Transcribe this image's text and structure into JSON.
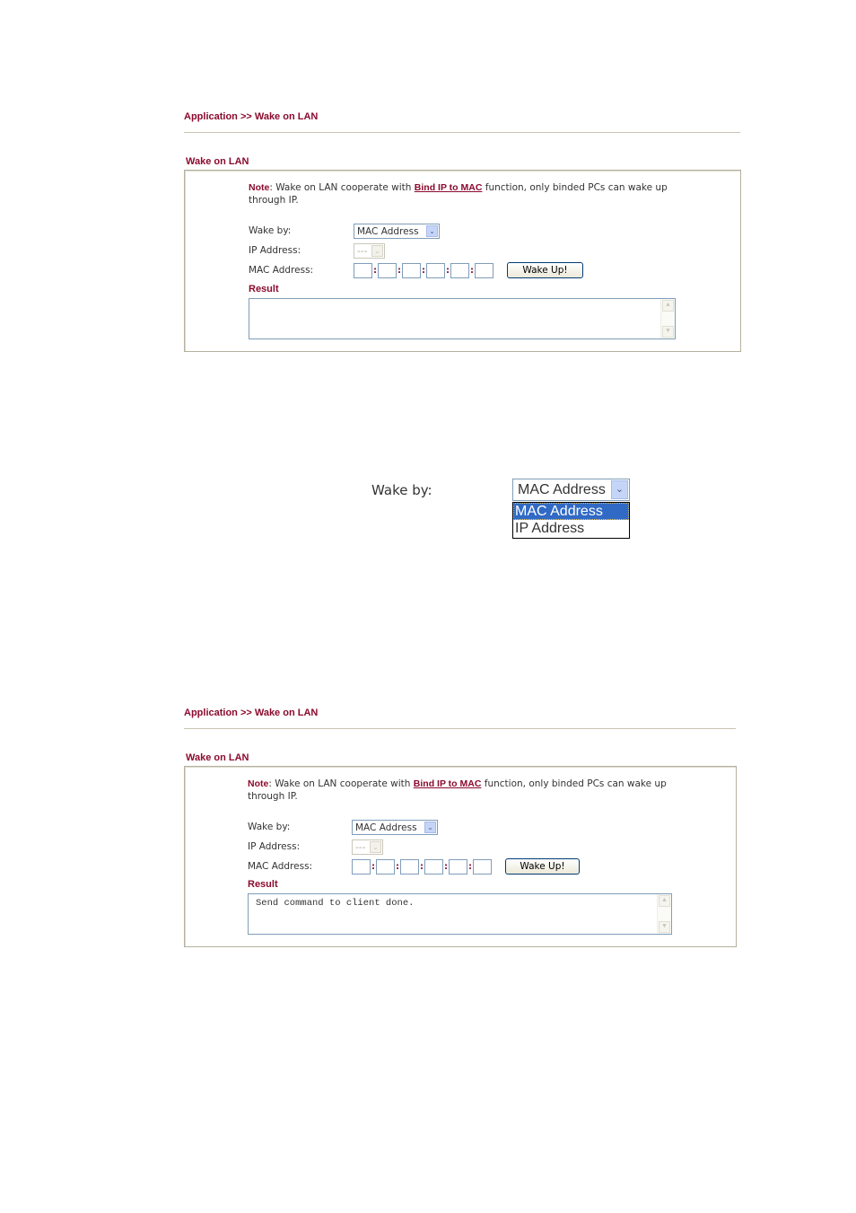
{
  "panel1": {
    "breadcrumb": "Application >> Wake on LAN",
    "section_title": "Wake on LAN",
    "note_label": "Note",
    "note_text_before": ": Wake on LAN cooperate with ",
    "note_link": "Bind IP to MAC",
    "note_text_after": " function,  only binded PCs can wake up through IP.",
    "wake_by_label": "Wake by:",
    "wake_by_value": "MAC Address",
    "ip_address_label": "IP Address:",
    "ip_address_value": "---",
    "mac_address_label": "MAC Address:",
    "mac_separator": ":",
    "wake_button": "Wake Up!",
    "result_label": "Result",
    "result_text": ""
  },
  "dropdown_example": {
    "label": "Wake by:",
    "selected": "MAC Address",
    "options": [
      "MAC Address",
      "IP Address"
    ]
  },
  "panel2": {
    "breadcrumb": "Application >> Wake on LAN",
    "section_title": "Wake on LAN",
    "note_label": "Note",
    "note_text_before": ": Wake on LAN cooperate with ",
    "note_link": "Bind IP to MAC",
    "note_text_after": " function,  only binded PCs can wake up through IP.",
    "wake_by_label": "Wake by:",
    "wake_by_value": "MAC Address",
    "ip_address_label": "IP Address:",
    "ip_address_value": "---",
    "mac_address_label": "MAC Address:",
    "mac_separator": ":",
    "wake_button": "Wake Up!",
    "result_label": "Result",
    "result_text": "Send command to client done."
  },
  "icons": {
    "dropdown_arrow": "⌄",
    "scroll_up": "▲",
    "scroll_down": "▼"
  }
}
